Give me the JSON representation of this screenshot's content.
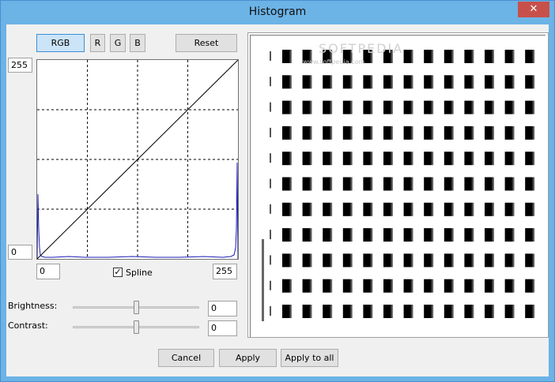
{
  "window": {
    "title": "Histogram",
    "close_glyph": "✕"
  },
  "channels": {
    "rgb": "RGB",
    "r": "R",
    "g": "G",
    "b": "B"
  },
  "reset_label": "Reset",
  "graph": {
    "y_max": "255",
    "y_min": "0",
    "x_min": "0",
    "x_max": "255",
    "spline_checked": true,
    "spline_label": "Spline",
    "spline_mark": "✓"
  },
  "adjustments": {
    "brightness_label": "Brightness:",
    "brightness_value": "0",
    "brightness_level": 0.5,
    "contrast_label": "Contrast:",
    "contrast_value": "0",
    "contrast_level": 0.5
  },
  "footer": {
    "cancel": "Cancel",
    "apply": "Apply",
    "apply_all": "Apply to all"
  },
  "preview": {
    "watermark": "SOFTPEDIA",
    "watermark_sub": "www.softpedia.com"
  },
  "colors": {
    "title_bar": "#6cb3e6",
    "close": "#c7514a",
    "histogram": "#1a1ab4",
    "active_button": "#cce4f7"
  }
}
